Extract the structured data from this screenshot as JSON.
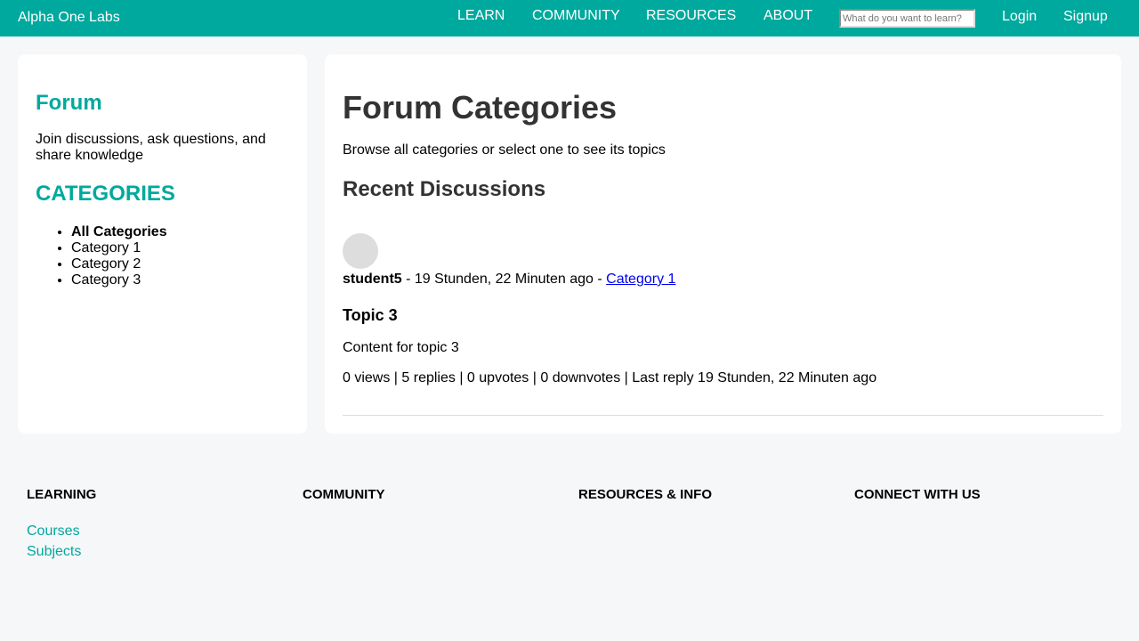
{
  "nav": {
    "brand": "Alpha One Labs",
    "links": [
      "LEARN",
      "COMMUNITY",
      "RESOURCES",
      "ABOUT"
    ],
    "search_placeholder": "What do you want to learn?",
    "login": "Login",
    "signup": "Signup"
  },
  "sidebar": {
    "title": "Forum",
    "description": "Join discussions, ask questions, and share knowledge",
    "categories_title": "CATEGORIES",
    "categories": [
      "All Categories",
      "Category 1",
      "Category 2",
      "Category 3"
    ]
  },
  "main": {
    "title": "Forum Categories",
    "subtitle": "Browse all categories or select one to see its topics",
    "recent_title": "Recent Discussions",
    "post": {
      "author": "student5",
      "time": " - 19 Stunden, 22 Minuten ago - ",
      "category": "Category 1",
      "title": "Topic 3",
      "content": "Content for topic 3",
      "stats": "0 views | 5 replies | 0 upvotes | 0 downvotes | Last reply 19 Stunden, 22 Minuten ago"
    }
  },
  "footer": {
    "columns": [
      {
        "heading": "LEARNING",
        "links": [
          "Courses",
          "Subjects"
        ]
      },
      {
        "heading": "COMMUNITY",
        "links": []
      },
      {
        "heading": "RESOURCES & INFO",
        "links": []
      },
      {
        "heading": "CONNECT WITH US",
        "links": []
      }
    ]
  },
  "colors": {
    "accent": "#00a99d",
    "background": "#f6f7f9",
    "card": "#ffffff",
    "heading": "#333333",
    "link": "#0000ee"
  }
}
